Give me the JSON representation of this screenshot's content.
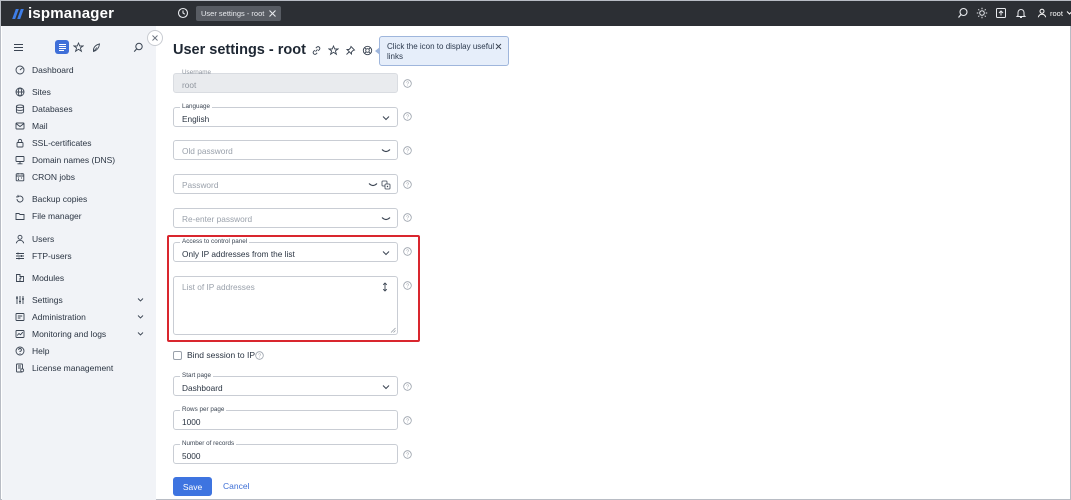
{
  "app": {
    "logo_text": "ispmanager"
  },
  "topbar": {
    "tab_label": "User settings - root",
    "user_label": "root"
  },
  "sidebar": {
    "items": [
      {
        "label": "Dashboard",
        "icon": "dashboard-icon"
      },
      {
        "label": "Sites",
        "icon": "globe-icon"
      },
      {
        "label": "Databases",
        "icon": "database-icon"
      },
      {
        "label": "Mail",
        "icon": "mail-icon"
      },
      {
        "label": "SSL-certificates",
        "icon": "lock-icon"
      },
      {
        "label": "Domain names (DNS)",
        "icon": "dns-icon"
      },
      {
        "label": "CRON jobs",
        "icon": "calendar-icon"
      },
      {
        "label": "Backup copies",
        "icon": "backup-icon"
      },
      {
        "label": "File manager",
        "icon": "folder-icon"
      },
      {
        "label": "Users",
        "icon": "user-icon"
      },
      {
        "label": "FTP-users",
        "icon": "ftp-icon"
      },
      {
        "label": "Modules",
        "icon": "modules-icon"
      },
      {
        "label": "Settings",
        "icon": "settings-icon"
      },
      {
        "label": "Administration",
        "icon": "administration-icon"
      },
      {
        "label": "Monitoring and logs",
        "icon": "monitoring-icon"
      },
      {
        "label": "Help",
        "icon": "help-icon"
      },
      {
        "label": "License management",
        "icon": "license-icon"
      }
    ]
  },
  "main": {
    "title": "User settings - root",
    "tooltip_text": "Click the icon to display useful links",
    "form": {
      "username": {
        "label": "Username",
        "value": "root"
      },
      "language": {
        "label": "Language",
        "value": "English"
      },
      "old_password": {
        "placeholder": "Old password"
      },
      "password": {
        "placeholder": "Password"
      },
      "reenter_password": {
        "placeholder": "Re-enter password"
      },
      "access": {
        "label": "Access to control panel",
        "value": "Only IP addresses from the list"
      },
      "ip_list": {
        "placeholder": "List of IP addresses"
      },
      "bind_session": {
        "label": "Bind session to IP",
        "checked": false
      },
      "start_page": {
        "label": "Start page",
        "value": "Dashboard"
      },
      "rows_per_page": {
        "label": "Rows per page",
        "value": "1000"
      },
      "number_of_records": {
        "label": "Number of records",
        "value": "5000"
      }
    },
    "buttons": {
      "save": "Save",
      "cancel": "Cancel"
    }
  },
  "colors": {
    "topbar": "#2c2f34",
    "accent": "#3e74e0",
    "highlight": "#d9262e",
    "sidebar_bg": "#f1f3f7"
  }
}
